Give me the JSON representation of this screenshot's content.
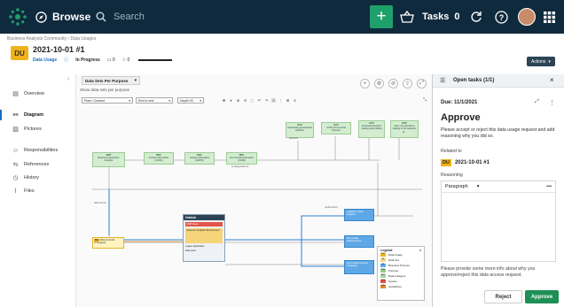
{
  "topbar": {
    "browse_label": "Browse",
    "search_placeholder": "Search",
    "tasks_label": "Tasks",
    "tasks_count": "0"
  },
  "breadcrumb": {
    "community": "Business Analysts Community",
    "separator": "›",
    "domain": "Data Usages"
  },
  "asset": {
    "type_badge": "DU",
    "title": "2021-10-01 #1",
    "type_label": "Data Usage",
    "status": "In Progress",
    "comments": "0",
    "rating": "0"
  },
  "actions_label": "Actions",
  "sidebar": {
    "items": [
      {
        "label": "Overview"
      },
      {
        "label": "Diagram"
      },
      {
        "label": "Pictures"
      },
      {
        "label": "Responsibilities"
      },
      {
        "label": "References"
      },
      {
        "label": "History"
      },
      {
        "label": "Files"
      }
    ]
  },
  "diagram": {
    "purpose_dropdown": "Data Sets Per Purpose",
    "show_label": "Show data sets per purpose",
    "layout_dropdown": "Flow / Context",
    "direction_dropdown": "End to end",
    "depth_dropdown": "Depth 03",
    "nodes": [
      {
        "badge": "BOP",
        "text": "Business Operations Analysis"
      },
      {
        "badge": "DDC",
        "text": "Contact information (CCPA)"
      },
      {
        "badge": "DDC",
        "text": "Contact information (GDPR)"
      },
      {
        "badge": "DDC",
        "text": "Commercial information (CCPA)"
      },
      {
        "badge": "DUP",
        "text": "Conducting promotional activities"
      },
      {
        "badge": "DUP",
        "text": "CCPA Commercial Purpose"
      },
      {
        "badge": "DUP",
        "text": "Automated decision making and profiling"
      },
      {
        "badge": "DUP",
        "text": "Carry out operations relating to the selection of..."
      }
    ],
    "process_nodes": [
      {
        "text": "Customer Churn Analysis"
      },
      {
        "text": "Print media advertisement"
      },
      {
        "text": "Non Product Launch Campaign"
      }
    ],
    "data_usage": {
      "badge": "DU",
      "text": "2021-10-01 #1",
      "status": "In Progress"
    },
    "system": {
      "header": "Outlook",
      "row1": "CRM Views",
      "row2": "Customer Analytics Environment",
      "row3": "Legacy Application",
      "row4": "Data store"
    },
    "edge_labels": [
      "performs",
      "data source",
      "is categorized as",
      "performed by"
    ],
    "legend": {
      "title": "Legend",
      "items": [
        {
          "sw": "DU",
          "label": "Data Usage",
          "color": "#f0b21b"
        },
        {
          "sw": "DS",
          "label": "Data Set",
          "color": "#f5d47a"
        },
        {
          "sw": "BP",
          "label": "Business Process",
          "color": "#5fa8e8"
        },
        {
          "sw": "DUP",
          "label": "Purpose",
          "color": "#8fd08a"
        },
        {
          "sw": "DDC",
          "label": "Data Category",
          "color": "#a7d9a2"
        },
        {
          "sw": "SYS",
          "label": "System",
          "color": "#e3554a"
        },
        {
          "sw": "JUR",
          "label": "Jurisdiction",
          "color": "#e08a2a"
        }
      ]
    }
  },
  "panel": {
    "header": "Open tasks (1/1)",
    "due": "Due: 11/1/2021",
    "title": "Approve",
    "description": "Please accept or reject this data usage request and add reasoning why you did so.",
    "related_label": "Related to",
    "related_badge": "DU",
    "related_value": "2021-10-01 #1",
    "reasoning_label": "Reasoning",
    "paragraph_option": "Paragraph",
    "help": "Please provide some more info about why you approve/reject this data access request.",
    "reject_label": "Reject",
    "approve_label": "Approve"
  }
}
